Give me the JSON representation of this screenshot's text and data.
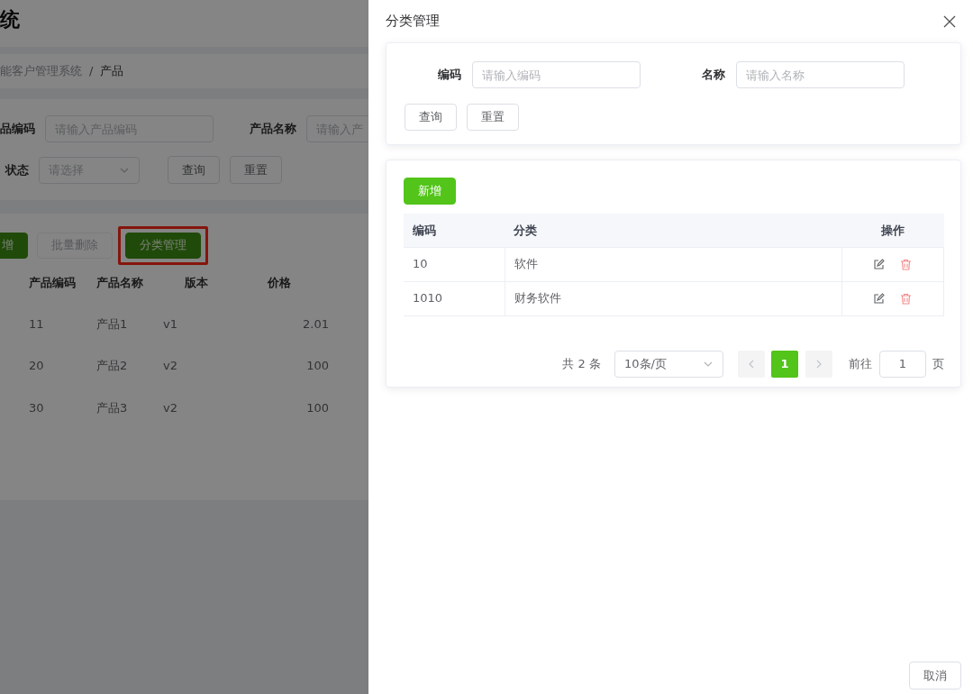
{
  "background_page": {
    "title_fragment": "统",
    "breadcrumb": [
      {
        "label": "能客户管理系统"
      },
      {
        "label": "产品"
      }
    ],
    "breadcrumb_separator": "/",
    "search_fields": [
      {
        "label": "品编码",
        "placeholder": "请输入产品编码"
      },
      {
        "label": "产品名称",
        "placeholder": "请输入产"
      }
    ],
    "status_field": {
      "label": "状态",
      "placeholder": "请选择"
    },
    "search_buttons": [
      "查询",
      "重置"
    ],
    "toolbar_buttons": [
      {
        "label": "增",
        "kind": "primary",
        "disabled": false,
        "highlighted": false
      },
      {
        "label": "批量删除",
        "kind": "plain",
        "disabled": true,
        "highlighted": false
      },
      {
        "label": "分类管理",
        "kind": "primary",
        "disabled": false,
        "highlighted": true
      }
    ],
    "table": {
      "columns": [
        "产品编码",
        "产品名称",
        "版本",
        "价格"
      ],
      "rows": [
        [
          "11",
          "产品1",
          "v1",
          "2.01"
        ],
        [
          "20",
          "产品2",
          "v2",
          "100"
        ],
        [
          "30",
          "产品3",
          "v2",
          "100"
        ]
      ]
    }
  },
  "drawer": {
    "title": "分类管理",
    "query_fields": [
      {
        "label": "编码",
        "placeholder": "请输入编码"
      },
      {
        "label": "名称",
        "placeholder": "请输入名称"
      }
    ],
    "query_buttons": [
      "查询",
      "重置"
    ],
    "add_button": "新增",
    "table": {
      "columns": [
        "编码",
        "分类",
        "操作"
      ],
      "rows": [
        [
          "10",
          "软件"
        ],
        [
          "1010",
          "财务软件"
        ]
      ]
    },
    "pagination": {
      "total": "共 2 条",
      "page_size": "10条/页",
      "pages": [
        {
          "label": "1",
          "selected": true
        }
      ],
      "goto_label": "前往",
      "goto_value": "1",
      "goto_suffix": "页"
    },
    "footer_buttons": [
      "取消"
    ]
  }
}
